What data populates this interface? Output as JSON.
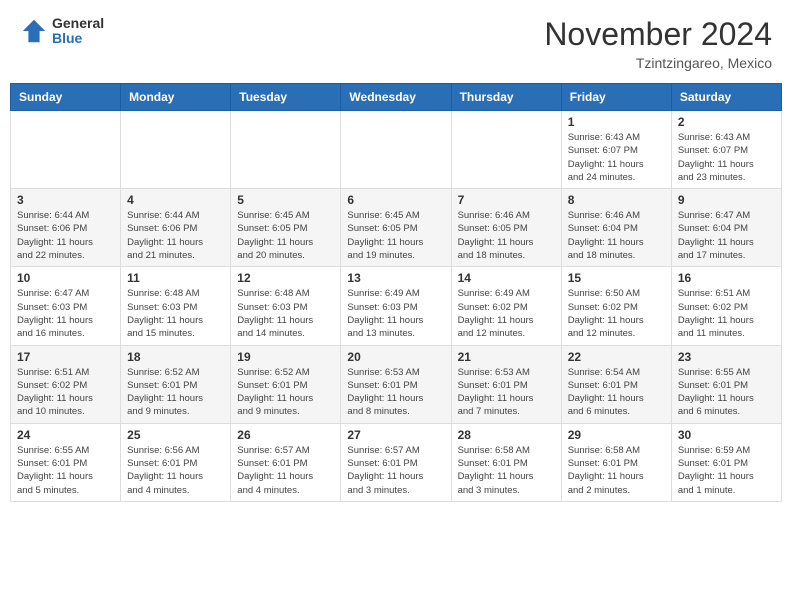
{
  "header": {
    "logo_general": "General",
    "logo_blue": "Blue",
    "month_title": "November 2024",
    "subtitle": "Tzintzingareo, Mexico"
  },
  "days_of_week": [
    "Sunday",
    "Monday",
    "Tuesday",
    "Wednesday",
    "Thursday",
    "Friday",
    "Saturday"
  ],
  "weeks": [
    [
      {
        "day": "",
        "detail": ""
      },
      {
        "day": "",
        "detail": ""
      },
      {
        "day": "",
        "detail": ""
      },
      {
        "day": "",
        "detail": ""
      },
      {
        "day": "",
        "detail": ""
      },
      {
        "day": "1",
        "detail": "Sunrise: 6:43 AM\nSunset: 6:07 PM\nDaylight: 11 hours\nand 24 minutes."
      },
      {
        "day": "2",
        "detail": "Sunrise: 6:43 AM\nSunset: 6:07 PM\nDaylight: 11 hours\nand 23 minutes."
      }
    ],
    [
      {
        "day": "3",
        "detail": "Sunrise: 6:44 AM\nSunset: 6:06 PM\nDaylight: 11 hours\nand 22 minutes."
      },
      {
        "day": "4",
        "detail": "Sunrise: 6:44 AM\nSunset: 6:06 PM\nDaylight: 11 hours\nand 21 minutes."
      },
      {
        "day": "5",
        "detail": "Sunrise: 6:45 AM\nSunset: 6:05 PM\nDaylight: 11 hours\nand 20 minutes."
      },
      {
        "day": "6",
        "detail": "Sunrise: 6:45 AM\nSunset: 6:05 PM\nDaylight: 11 hours\nand 19 minutes."
      },
      {
        "day": "7",
        "detail": "Sunrise: 6:46 AM\nSunset: 6:05 PM\nDaylight: 11 hours\nand 18 minutes."
      },
      {
        "day": "8",
        "detail": "Sunrise: 6:46 AM\nSunset: 6:04 PM\nDaylight: 11 hours\nand 18 minutes."
      },
      {
        "day": "9",
        "detail": "Sunrise: 6:47 AM\nSunset: 6:04 PM\nDaylight: 11 hours\nand 17 minutes."
      }
    ],
    [
      {
        "day": "10",
        "detail": "Sunrise: 6:47 AM\nSunset: 6:03 PM\nDaylight: 11 hours\nand 16 minutes."
      },
      {
        "day": "11",
        "detail": "Sunrise: 6:48 AM\nSunset: 6:03 PM\nDaylight: 11 hours\nand 15 minutes."
      },
      {
        "day": "12",
        "detail": "Sunrise: 6:48 AM\nSunset: 6:03 PM\nDaylight: 11 hours\nand 14 minutes."
      },
      {
        "day": "13",
        "detail": "Sunrise: 6:49 AM\nSunset: 6:03 PM\nDaylight: 11 hours\nand 13 minutes."
      },
      {
        "day": "14",
        "detail": "Sunrise: 6:49 AM\nSunset: 6:02 PM\nDaylight: 11 hours\nand 12 minutes."
      },
      {
        "day": "15",
        "detail": "Sunrise: 6:50 AM\nSunset: 6:02 PM\nDaylight: 11 hours\nand 12 minutes."
      },
      {
        "day": "16",
        "detail": "Sunrise: 6:51 AM\nSunset: 6:02 PM\nDaylight: 11 hours\nand 11 minutes."
      }
    ],
    [
      {
        "day": "17",
        "detail": "Sunrise: 6:51 AM\nSunset: 6:02 PM\nDaylight: 11 hours\nand 10 minutes."
      },
      {
        "day": "18",
        "detail": "Sunrise: 6:52 AM\nSunset: 6:01 PM\nDaylight: 11 hours\nand 9 minutes."
      },
      {
        "day": "19",
        "detail": "Sunrise: 6:52 AM\nSunset: 6:01 PM\nDaylight: 11 hours\nand 9 minutes."
      },
      {
        "day": "20",
        "detail": "Sunrise: 6:53 AM\nSunset: 6:01 PM\nDaylight: 11 hours\nand 8 minutes."
      },
      {
        "day": "21",
        "detail": "Sunrise: 6:53 AM\nSunset: 6:01 PM\nDaylight: 11 hours\nand 7 minutes."
      },
      {
        "day": "22",
        "detail": "Sunrise: 6:54 AM\nSunset: 6:01 PM\nDaylight: 11 hours\nand 6 minutes."
      },
      {
        "day": "23",
        "detail": "Sunrise: 6:55 AM\nSunset: 6:01 PM\nDaylight: 11 hours\nand 6 minutes."
      }
    ],
    [
      {
        "day": "24",
        "detail": "Sunrise: 6:55 AM\nSunset: 6:01 PM\nDaylight: 11 hours\nand 5 minutes."
      },
      {
        "day": "25",
        "detail": "Sunrise: 6:56 AM\nSunset: 6:01 PM\nDaylight: 11 hours\nand 4 minutes."
      },
      {
        "day": "26",
        "detail": "Sunrise: 6:57 AM\nSunset: 6:01 PM\nDaylight: 11 hours\nand 4 minutes."
      },
      {
        "day": "27",
        "detail": "Sunrise: 6:57 AM\nSunset: 6:01 PM\nDaylight: 11 hours\nand 3 minutes."
      },
      {
        "day": "28",
        "detail": "Sunrise: 6:58 AM\nSunset: 6:01 PM\nDaylight: 11 hours\nand 3 minutes."
      },
      {
        "day": "29",
        "detail": "Sunrise: 6:58 AM\nSunset: 6:01 PM\nDaylight: 11 hours\nand 2 minutes."
      },
      {
        "day": "30",
        "detail": "Sunrise: 6:59 AM\nSunset: 6:01 PM\nDaylight: 11 hours\nand 1 minute."
      }
    ]
  ]
}
